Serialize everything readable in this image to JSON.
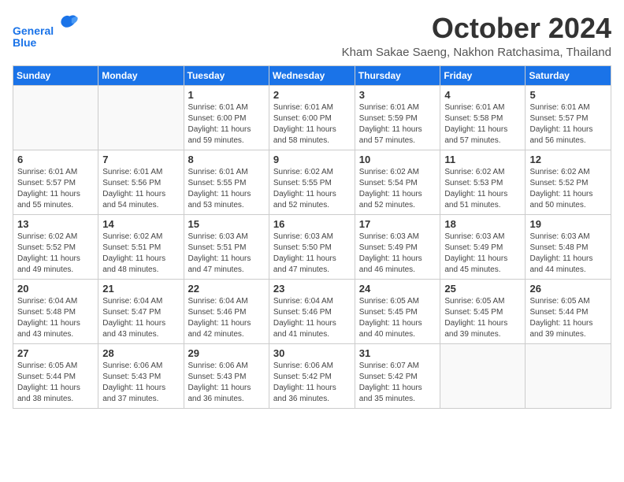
{
  "header": {
    "logo_line1": "General",
    "logo_line2": "Blue",
    "month": "October 2024",
    "location": "Kham Sakae Saeng, Nakhon Ratchasima, Thailand"
  },
  "weekdays": [
    "Sunday",
    "Monday",
    "Tuesday",
    "Wednesday",
    "Thursday",
    "Friday",
    "Saturday"
  ],
  "weeks": [
    [
      {
        "day": "",
        "info": ""
      },
      {
        "day": "",
        "info": ""
      },
      {
        "day": "1",
        "info": "Sunrise: 6:01 AM\nSunset: 6:00 PM\nDaylight: 11 hours and 59 minutes."
      },
      {
        "day": "2",
        "info": "Sunrise: 6:01 AM\nSunset: 6:00 PM\nDaylight: 11 hours and 58 minutes."
      },
      {
        "day": "3",
        "info": "Sunrise: 6:01 AM\nSunset: 5:59 PM\nDaylight: 11 hours and 57 minutes."
      },
      {
        "day": "4",
        "info": "Sunrise: 6:01 AM\nSunset: 5:58 PM\nDaylight: 11 hours and 57 minutes."
      },
      {
        "day": "5",
        "info": "Sunrise: 6:01 AM\nSunset: 5:57 PM\nDaylight: 11 hours and 56 minutes."
      }
    ],
    [
      {
        "day": "6",
        "info": "Sunrise: 6:01 AM\nSunset: 5:57 PM\nDaylight: 11 hours and 55 minutes."
      },
      {
        "day": "7",
        "info": "Sunrise: 6:01 AM\nSunset: 5:56 PM\nDaylight: 11 hours and 54 minutes."
      },
      {
        "day": "8",
        "info": "Sunrise: 6:01 AM\nSunset: 5:55 PM\nDaylight: 11 hours and 53 minutes."
      },
      {
        "day": "9",
        "info": "Sunrise: 6:02 AM\nSunset: 5:55 PM\nDaylight: 11 hours and 52 minutes."
      },
      {
        "day": "10",
        "info": "Sunrise: 6:02 AM\nSunset: 5:54 PM\nDaylight: 11 hours and 52 minutes."
      },
      {
        "day": "11",
        "info": "Sunrise: 6:02 AM\nSunset: 5:53 PM\nDaylight: 11 hours and 51 minutes."
      },
      {
        "day": "12",
        "info": "Sunrise: 6:02 AM\nSunset: 5:52 PM\nDaylight: 11 hours and 50 minutes."
      }
    ],
    [
      {
        "day": "13",
        "info": "Sunrise: 6:02 AM\nSunset: 5:52 PM\nDaylight: 11 hours and 49 minutes."
      },
      {
        "day": "14",
        "info": "Sunrise: 6:02 AM\nSunset: 5:51 PM\nDaylight: 11 hours and 48 minutes."
      },
      {
        "day": "15",
        "info": "Sunrise: 6:03 AM\nSunset: 5:51 PM\nDaylight: 11 hours and 47 minutes."
      },
      {
        "day": "16",
        "info": "Sunrise: 6:03 AM\nSunset: 5:50 PM\nDaylight: 11 hours and 47 minutes."
      },
      {
        "day": "17",
        "info": "Sunrise: 6:03 AM\nSunset: 5:49 PM\nDaylight: 11 hours and 46 minutes."
      },
      {
        "day": "18",
        "info": "Sunrise: 6:03 AM\nSunset: 5:49 PM\nDaylight: 11 hours and 45 minutes."
      },
      {
        "day": "19",
        "info": "Sunrise: 6:03 AM\nSunset: 5:48 PM\nDaylight: 11 hours and 44 minutes."
      }
    ],
    [
      {
        "day": "20",
        "info": "Sunrise: 6:04 AM\nSunset: 5:48 PM\nDaylight: 11 hours and 43 minutes."
      },
      {
        "day": "21",
        "info": "Sunrise: 6:04 AM\nSunset: 5:47 PM\nDaylight: 11 hours and 43 minutes."
      },
      {
        "day": "22",
        "info": "Sunrise: 6:04 AM\nSunset: 5:46 PM\nDaylight: 11 hours and 42 minutes."
      },
      {
        "day": "23",
        "info": "Sunrise: 6:04 AM\nSunset: 5:46 PM\nDaylight: 11 hours and 41 minutes."
      },
      {
        "day": "24",
        "info": "Sunrise: 6:05 AM\nSunset: 5:45 PM\nDaylight: 11 hours and 40 minutes."
      },
      {
        "day": "25",
        "info": "Sunrise: 6:05 AM\nSunset: 5:45 PM\nDaylight: 11 hours and 39 minutes."
      },
      {
        "day": "26",
        "info": "Sunrise: 6:05 AM\nSunset: 5:44 PM\nDaylight: 11 hours and 39 minutes."
      }
    ],
    [
      {
        "day": "27",
        "info": "Sunrise: 6:05 AM\nSunset: 5:44 PM\nDaylight: 11 hours and 38 minutes."
      },
      {
        "day": "28",
        "info": "Sunrise: 6:06 AM\nSunset: 5:43 PM\nDaylight: 11 hours and 37 minutes."
      },
      {
        "day": "29",
        "info": "Sunrise: 6:06 AM\nSunset: 5:43 PM\nDaylight: 11 hours and 36 minutes."
      },
      {
        "day": "30",
        "info": "Sunrise: 6:06 AM\nSunset: 5:42 PM\nDaylight: 11 hours and 36 minutes."
      },
      {
        "day": "31",
        "info": "Sunrise: 6:07 AM\nSunset: 5:42 PM\nDaylight: 11 hours and 35 minutes."
      },
      {
        "day": "",
        "info": ""
      },
      {
        "day": "",
        "info": ""
      }
    ]
  ]
}
